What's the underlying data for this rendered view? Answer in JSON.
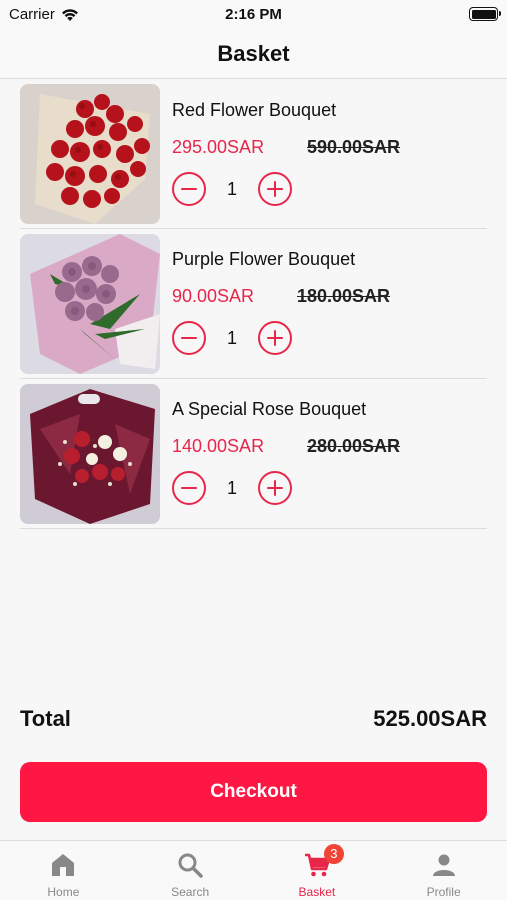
{
  "status_bar": {
    "carrier": "Carrier",
    "time": "2:16 PM"
  },
  "header": {
    "title": "Basket"
  },
  "items": [
    {
      "name": "Red Flower Bouquet",
      "price": "295.00SAR",
      "old_price": "590.00SAR",
      "quantity": "1"
    },
    {
      "name": "Purple Flower Bouquet",
      "price": "90.00SAR",
      "old_price": "180.00SAR",
      "quantity": "1"
    },
    {
      "name": "A Special Rose Bouquet",
      "price": "140.00SAR",
      "old_price": "280.00SAR",
      "quantity": "1"
    }
  ],
  "summary": {
    "total_label": "Total",
    "total_value": "525.00SAR"
  },
  "checkout_label": "Checkout",
  "tabbar": {
    "tabs": [
      {
        "label": "Home",
        "icon": "home-icon"
      },
      {
        "label": "Search",
        "icon": "search-icon"
      },
      {
        "label": "Basket",
        "icon": "cart-icon",
        "badge": "3",
        "active": true
      },
      {
        "label": "Profile",
        "icon": "person-icon"
      }
    ]
  },
  "colors": {
    "accent": "#e8264a",
    "checkout": "#ff1744",
    "badge": "#f04437",
    "inactive": "#888888"
  }
}
